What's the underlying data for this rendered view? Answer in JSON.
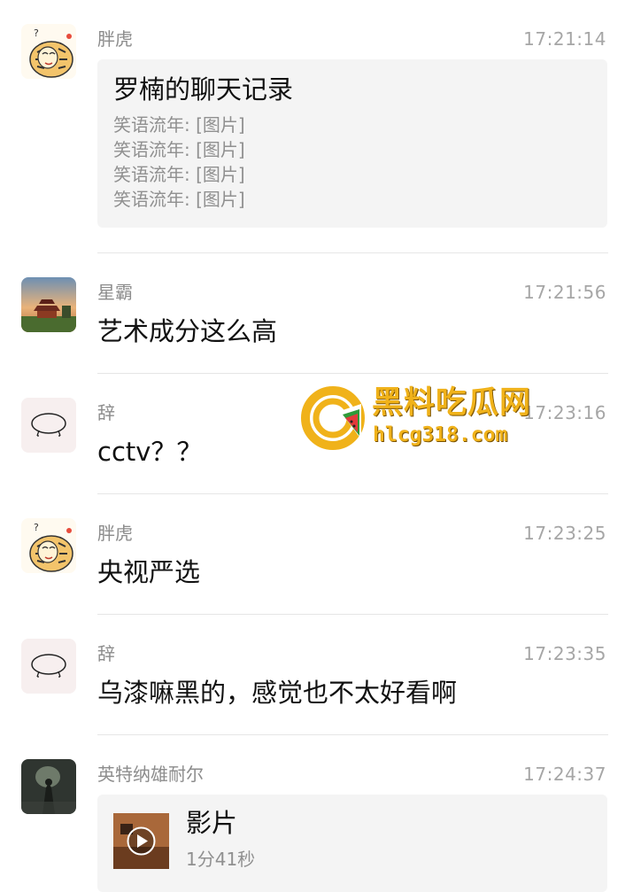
{
  "messages": [
    {
      "sender": "胖虎",
      "time": "17:21:14",
      "avatar": "tiger-avatar",
      "type": "chat-record",
      "card": {
        "title": "罗楠的聊天记录",
        "lines": [
          "笑语流年: [图片]",
          "笑语流年: [图片]",
          "笑语流年: [图片]",
          "笑语流年: [图片]"
        ]
      }
    },
    {
      "sender": "星霸",
      "time": "17:21:56",
      "avatar": "palace-photo-avatar",
      "type": "text",
      "text": "艺术成分这么高"
    },
    {
      "sender": "辞",
      "time": "17:23:16",
      "avatar": "sketch-avatar",
      "type": "text",
      "text": "cctv？？"
    },
    {
      "sender": "胖虎",
      "time": "17:23:25",
      "avatar": "tiger-avatar",
      "type": "text",
      "text": "央视严选"
    },
    {
      "sender": "辞",
      "time": "17:23:35",
      "avatar": "sketch-avatar",
      "type": "text",
      "text": "乌漆嘛黑的，感觉也不太好看啊"
    },
    {
      "sender": "英特纳雄耐尔",
      "time": "17:24:37",
      "avatar": "dark-photo-avatar",
      "type": "video",
      "video": {
        "title": "影片",
        "duration": "1分41秒"
      }
    }
  ],
  "watermark": {
    "title": "黑料吃瓜网",
    "url": "hlcg318.com"
  },
  "colors": {
    "background": "#ffffff",
    "card": "#f4f4f4",
    "meta_text": "#8c8c8c",
    "watermark": "#f0b21a"
  }
}
